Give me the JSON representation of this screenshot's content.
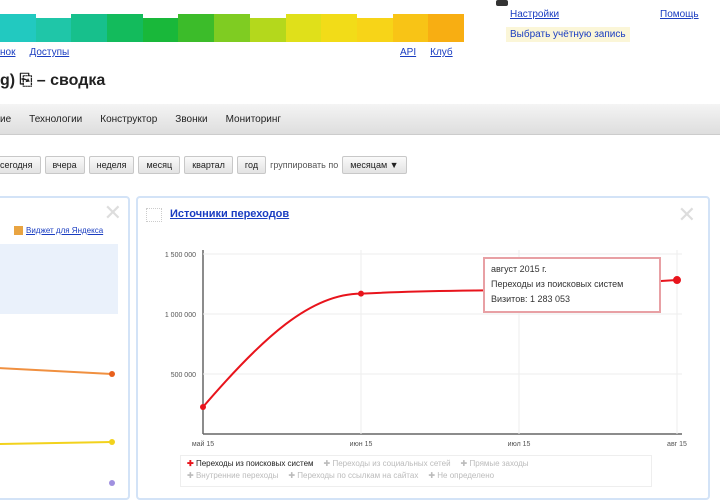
{
  "header": {
    "rainbow_colors": [
      "#22c9c0",
      "#1fc6a8",
      "#17c08c",
      "#13bb5c",
      "#19b83a",
      "#3cbc2a",
      "#7fcc22",
      "#b4d81c",
      "#e0e01a",
      "#f2dc18",
      "#f7d418",
      "#f8c416",
      "#f8ae12"
    ],
    "links_left": [
      "нок",
      "Доступы"
    ],
    "links_right": [
      "API",
      "Клуб"
    ],
    "user_menu": {
      "settings": "Настройки",
      "help": "Помощь",
      "choose_account": "Выбрать учётную запись"
    }
  },
  "page_title": "g) ⎘ – сводка",
  "nav": [
    "ие",
    "Технологии",
    "Конструктор",
    "Звонки",
    "Мониторинг"
  ],
  "periods": [
    "сегодня",
    "вчера",
    "неделя",
    "месяц",
    "квартал",
    "год"
  ],
  "group_by_label": "группировать по",
  "group_by_value": "месяцам ▼",
  "left_widget": {
    "link": "Виджет для Яндекса"
  },
  "sources_widget": {
    "title": "Источники переходов",
    "tooltip": {
      "date": "август 2015 г.",
      "series": "Переходы из поисковых систем",
      "value": "Визитов: 1 283 053"
    },
    "legend": [
      "Переходы из поисковых систем",
      "Переходы из социальных сетей",
      "Прямые заходы",
      "Внутренние переходы",
      "Переходы по ссылкам на сайтах",
      "Не определено"
    ]
  },
  "chart_data": {
    "type": "line",
    "title": "Источники переходов",
    "categories": [
      "май 15",
      "июн 15",
      "июл 15",
      "авг 15"
    ],
    "yticks": [
      "500 000",
      "1 000 000",
      "1 500 000"
    ],
    "ylim": [
      0,
      1500000
    ],
    "series": [
      {
        "name": "Переходы из поисковых систем",
        "color": "#e8141c",
        "values": [
          225000,
          1170000,
          1200000,
          1283053
        ]
      }
    ],
    "legend_position": "bottom"
  }
}
